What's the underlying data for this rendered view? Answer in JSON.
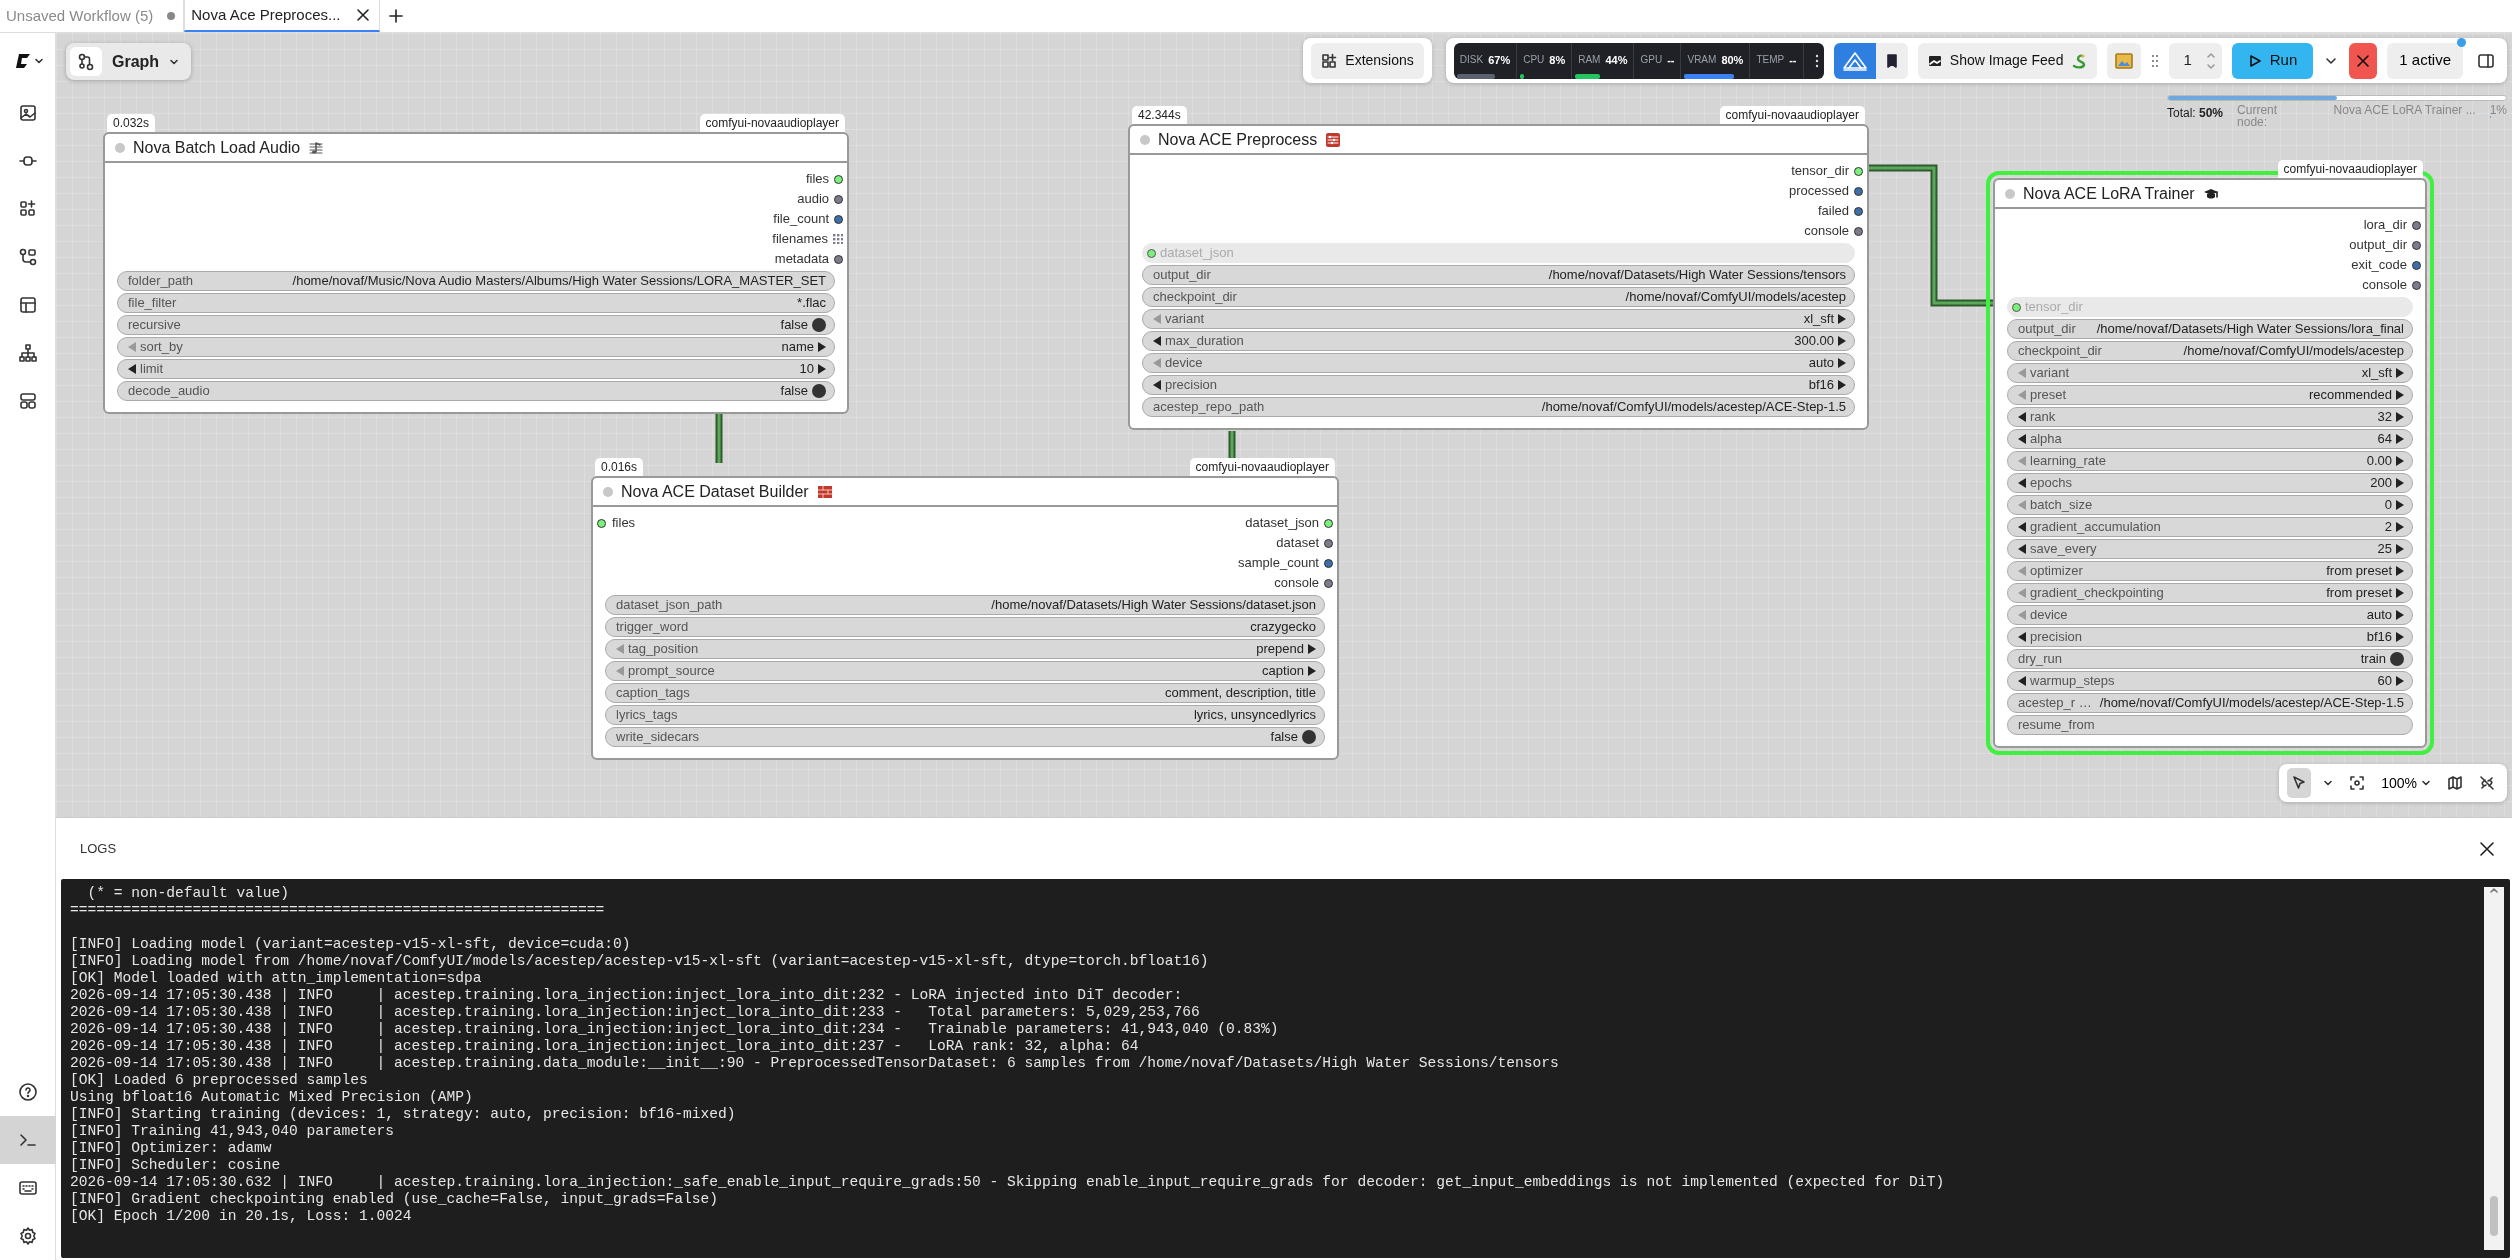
{
  "tabs": [
    {
      "label": "Unsaved Workflow (5)",
      "selected": false,
      "modified": true
    },
    {
      "label": "Nova Ace Preproces...",
      "selected": true,
      "modified": false
    }
  ],
  "sidebar": {
    "top_items": [
      {
        "selected": false
      },
      {
        "selected": false
      },
      {
        "selected": false
      },
      {
        "selected": false
      },
      {
        "selected": false
      },
      {
        "selected": false
      },
      {
        "selected": false
      }
    ],
    "bottom_items": [
      {
        "selected": false
      },
      {
        "selected": true
      },
      {
        "selected": false
      },
      {
        "selected": false
      }
    ]
  },
  "graph_button": {
    "label": "Graph"
  },
  "toolbar": {
    "extensions_label": "Extensions",
    "monitor": [
      {
        "label": "DISK",
        "value": "67%",
        "level": 0.67,
        "color": "#5b6170"
      },
      {
        "label": "CPU",
        "value": "8%",
        "level": 0.08,
        "color": "#22c55e"
      },
      {
        "label": "RAM",
        "value": "44%",
        "level": 0.44,
        "color": "#22c55e"
      },
      {
        "label": "GPU",
        "value": "--"
      },
      {
        "label": "VRAM",
        "value": "80%",
        "level": 0.8,
        "color": "#3b82f6"
      },
      {
        "label": "TEMP",
        "value": "--"
      }
    ],
    "image_feed_label": "Show Image Feed",
    "queue_count": "1",
    "run_label": "Run",
    "active_label": "1 active"
  },
  "progress": {
    "total_text": "Total: **50%**",
    "level": 0.5,
    "current_label": "Current node:",
    "current_node": "Nova ACE LoRA Trainer ...",
    "node_progress": {
      "text": "1%",
      "level": 0.01
    }
  },
  "nodes": [
    {
      "title": "Nova Batch Load Audio",
      "time": "0.032s",
      "source": "comfyui-novaaudioplayer",
      "active": false,
      "outputs": [
        {
          "name": "files",
          "kind": "dot",
          "color": "#7cf07c"
        },
        {
          "name": "audio",
          "kind": "dot",
          "color": "#7b7b8c"
        },
        {
          "name": "file_count",
          "kind": "dot",
          "color": "#3d6ea8"
        },
        {
          "name": "filenames",
          "kind": "list",
          "color": "#7b7b8c"
        },
        {
          "name": "metadata",
          "kind": "dot",
          "color": "#7b7b8c"
        }
      ],
      "widgets": [
        {
          "kind": "text",
          "label": "folder_path",
          "value": "/home/novaf/Music/Nova Audio Masters/Albums/High Water Sessions/LORA_MASTER_SET"
        },
        {
          "kind": "text",
          "label": "file_filter",
          "value": "*.flac"
        },
        {
          "kind": "toggle",
          "label": "recursive",
          "value": "false"
        },
        {
          "kind": "combo",
          "label": "sort_by",
          "value": "name",
          "left_disabled": true
        },
        {
          "kind": "combo",
          "label": "limit",
          "value": "10",
          "left_disabled": false
        },
        {
          "kind": "toggle",
          "label": "decode_audio",
          "value": "false"
        }
      ]
    },
    {
      "title": "Nova ACE Preprocess",
      "time": "42.344s",
      "source": "comfyui-novaaudioplayer",
      "active": false,
      "outputs": [
        {
          "name": "tensor_dir",
          "kind": "dot",
          "color": "#7cf07c"
        },
        {
          "name": "processed",
          "kind": "dot",
          "color": "#3d6ea8"
        },
        {
          "name": "failed",
          "kind": "dot",
          "color": "#3d6ea8"
        },
        {
          "name": "console",
          "kind": "dot",
          "color": "#7b7b8c"
        }
      ],
      "widgets": [
        {
          "kind": "linked",
          "label": "dataset_json",
          "color": "#7cf07c"
        },
        {
          "kind": "text",
          "label": "output_dir",
          "value": "/home/novaf/Datasets/High Water Sessions/tensors"
        },
        {
          "kind": "text",
          "label": "checkpoint_dir",
          "value": "/home/novaf/ComfyUI/models/acestep"
        },
        {
          "kind": "combo",
          "label": "variant",
          "value": "xl_sft",
          "left_disabled": true
        },
        {
          "kind": "combo",
          "label": "max_duration",
          "value": "300.00",
          "left_disabled": false
        },
        {
          "kind": "combo",
          "label": "device",
          "value": "auto",
          "left_disabled": true
        },
        {
          "kind": "combo",
          "label": "precision",
          "value": "bf16",
          "left_disabled": false
        },
        {
          "kind": "text",
          "label": "acestep_repo_path",
          "value": "/home/novaf/ComfyUI/models/acestep/ACE-Step-1.5"
        }
      ]
    },
    {
      "title": "Nova ACE LoRA Trainer",
      "source": "comfyui-novaaudioplayer",
      "active": true,
      "outputs": [
        {
          "name": "lora_dir",
          "kind": "dot",
          "color": "#7b7b8c"
        },
        {
          "name": "output_dir",
          "kind": "dot",
          "color": "#7b7b8c"
        },
        {
          "name": "exit_code",
          "kind": "dot",
          "color": "#3d6ea8"
        },
        {
          "name": "console",
          "kind": "dot",
          "color": "#7b7b8c"
        }
      ],
      "widgets": [
        {
          "kind": "linked",
          "label": "tensor_dir",
          "color": "#7cf07c"
        },
        {
          "kind": "text",
          "label": "output_dir",
          "value": "/home/novaf/Datasets/High Water Sessions/lora_final"
        },
        {
          "kind": "text",
          "label": "checkpoint_dir",
          "value": "/home/novaf/ComfyUI/models/acestep"
        },
        {
          "kind": "combo",
          "label": "variant",
          "value": "xl_sft",
          "left_disabled": true
        },
        {
          "kind": "combo",
          "label": "preset",
          "value": "recommended",
          "left_disabled": true
        },
        {
          "kind": "combo",
          "label": "rank",
          "value": "32",
          "left_disabled": false
        },
        {
          "kind": "combo",
          "label": "alpha",
          "value": "64",
          "left_disabled": false
        },
        {
          "kind": "combo",
          "label": "learning_rate",
          "value": "0.00",
          "left_disabled": true
        },
        {
          "kind": "combo",
          "label": "epochs",
          "value": "200",
          "left_disabled": false
        },
        {
          "kind": "combo",
          "label": "batch_size",
          "value": "0",
          "left_disabled": true
        },
        {
          "kind": "combo",
          "label": "gradient_accumulation",
          "value": "2",
          "left_disabled": false
        },
        {
          "kind": "combo",
          "label": "save_every",
          "value": "25",
          "left_disabled": false
        },
        {
          "kind": "combo",
          "label": "optimizer",
          "value": "from preset",
          "left_disabled": true
        },
        {
          "kind": "combo",
          "label": "gradient_checkpointing",
          "value": "from preset",
          "left_disabled": true
        },
        {
          "kind": "combo",
          "label": "device",
          "value": "auto",
          "left_disabled": true
        },
        {
          "kind": "combo",
          "label": "precision",
          "value": "bf16",
          "left_disabled": false
        },
        {
          "kind": "toggle",
          "label": "dry_run",
          "value": "train"
        },
        {
          "kind": "combo",
          "label": "warmup_steps",
          "value": "60",
          "left_disabled": false
        },
        {
          "kind": "text",
          "label": "acestep_r …",
          "value": "/home/novaf/ComfyUI/models/acestep/ACE-Step-1.5"
        },
        {
          "kind": "text",
          "label": "resume_from"
        }
      ]
    },
    {
      "title": "Nova ACE Dataset Builder",
      "time": "0.016s",
      "source": "comfyui-novaaudioplayer",
      "active": false,
      "inputs": [
        {
          "name": "files",
          "color": "#7cf07c"
        }
      ],
      "outputs": [
        {
          "name": "dataset_json",
          "kind": "dot",
          "color": "#7cf07c"
        },
        {
          "name": "dataset",
          "kind": "dot",
          "color": "#7b7b8c"
        },
        {
          "name": "sample_count",
          "kind": "dot",
          "color": "#3d6ea8"
        },
        {
          "name": "console",
          "kind": "dot",
          "color": "#7b7b8c"
        }
      ],
      "widgets": [
        {
          "kind": "text",
          "label": "dataset_json_path",
          "value": "/home/novaf/Datasets/High Water Sessions/dataset.json"
        },
        {
          "kind": "text",
          "label": "trigger_word",
          "value": "crazygecko"
        },
        {
          "kind": "combo",
          "label": "tag_position",
          "value": "prepend",
          "left_disabled": true
        },
        {
          "kind": "combo",
          "label": "prompt_source",
          "value": "caption",
          "left_disabled": true
        },
        {
          "kind": "text",
          "label": "caption_tags",
          "value": "comment, description, title"
        },
        {
          "kind": "text",
          "label": "lyrics_tags",
          "value": "lyrics, unsyncedlyrics"
        },
        {
          "kind": "toggle",
          "label": "write_sidecars",
          "value": "false"
        }
      ]
    }
  ],
  "canvas_controls": {
    "tools": [
      {
        "selected": true
      }
    ],
    "zoom": "100%"
  },
  "logs": {
    "title": "LOGS",
    "blocks": [
      [
        "  (* = non-default value)",
        "============================================================="
      ],
      [
        "[INFO] Loading model (variant=acestep-v15-xl-sft, device=cuda:0)",
        "[INFO] Loading model from /home/novaf/ComfyUI/models/acestep/acestep-v15-xl-sft (variant=acestep-v15-xl-sft, dtype=torch.bfloat16)",
        "[OK] Model loaded with attn_implementation=sdpa",
        "2026-09-14 17:05:30.438 | INFO     | acestep.training.lora_injection:inject_lora_into_dit:232 - LoRA injected into DiT decoder:",
        "2026-09-14 17:05:30.438 | INFO     | acestep.training.lora_injection:inject_lora_into_dit:233 -   Total parameters: 5,029,253,766",
        "2026-09-14 17:05:30.438 | INFO     | acestep.training.lora_injection:inject_lora_into_dit:234 -   Trainable parameters: 41,943,040 (0.83%)",
        "2026-09-14 17:05:30.438 | INFO     | acestep.training.lora_injection:inject_lora_into_dit:237 -   LoRA rank: 32, alpha: 64",
        "2026-09-14 17:05:30.438 | INFO     | acestep.training.data_module:__init__:90 - PreprocessedTensorDataset: 6 samples from /home/novaf/Datasets/High Water Sessions/tensors",
        "[OK] Loaded 6 preprocessed samples",
        "Using bfloat16 Automatic Mixed Precision (AMP)",
        "[INFO] Starting training (devices: 1, strategy: auto, precision: bf16-mixed)",
        "[INFO] Training 41,943,040 parameters",
        "[INFO] Optimizer: adamw",
        "[INFO] Scheduler: cosine",
        "2026-09-14 17:05:30.632 | INFO     | acestep.training.lora_injection:_safe_enable_input_require_grads:50 - Skipping enable_input_require_grads for decoder: get_input_embeddings is not implemented (expected for DiT)",
        "[INFO] Gradient checkpointing enabled (use_cache=False, input_grads=False)",
        "[OK] Epoch 1/200 in 20.1s, Loss: 1.0024"
      ]
    ]
  }
}
